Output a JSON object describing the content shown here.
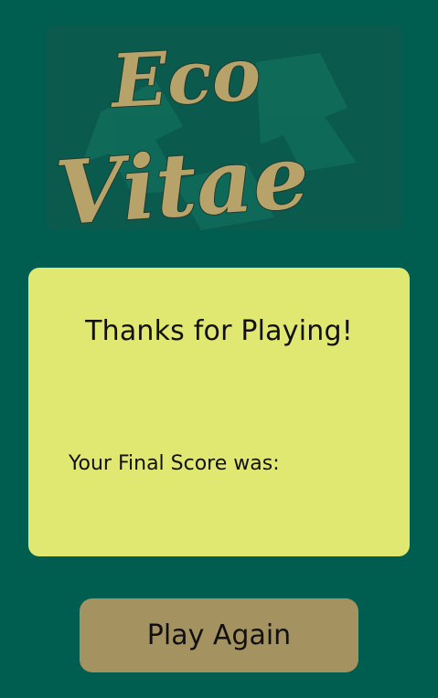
{
  "logo": {
    "line1": "Eco",
    "line2": "Vitae"
  },
  "card": {
    "title": "Thanks for Playing!",
    "score_label": "Your Final Score was:"
  },
  "actions": {
    "play_again_label": "Play Again"
  },
  "colors": {
    "background": "#005e50",
    "card": "#e1e872",
    "button": "#a49361",
    "logo_text": "#b7a36a"
  }
}
